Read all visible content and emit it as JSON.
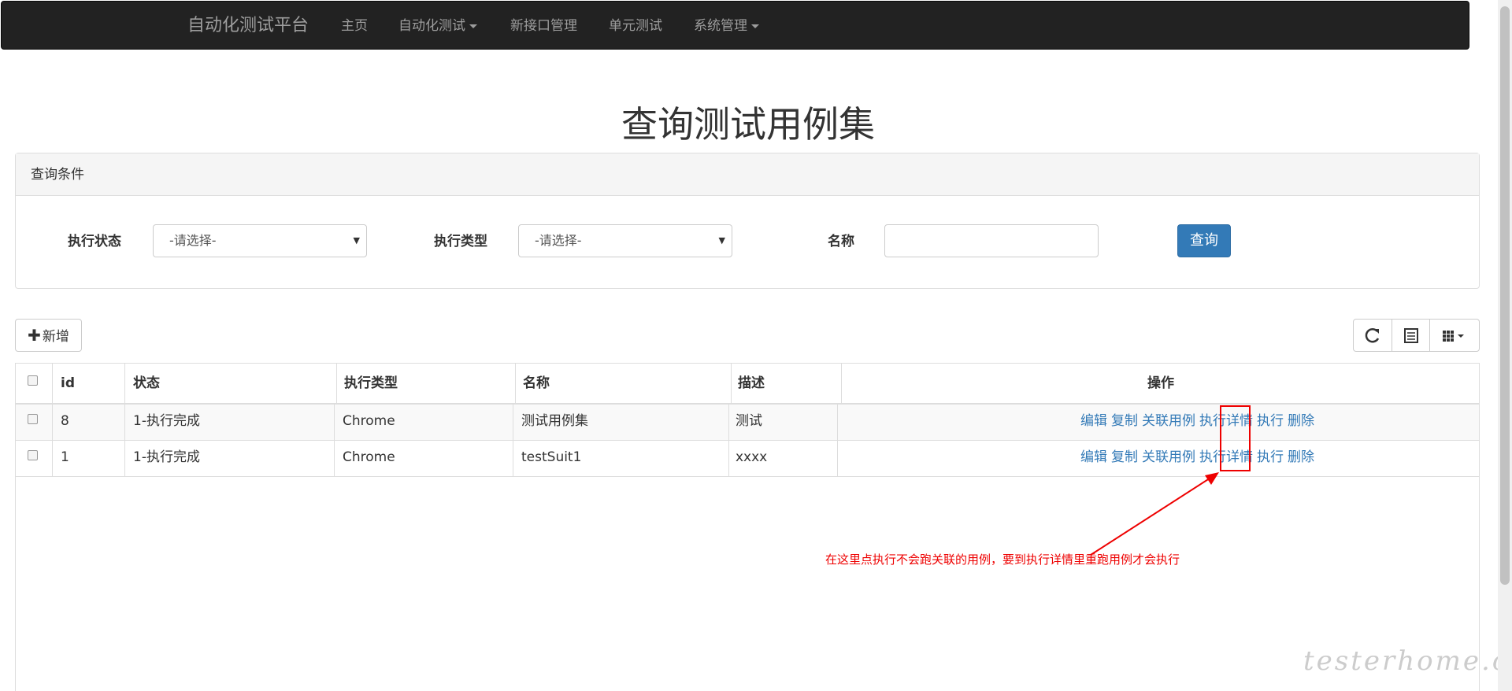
{
  "navbar": {
    "brand": "自动化测试平台",
    "items": [
      {
        "label": "主页"
      },
      {
        "label": "自动化测试"
      },
      {
        "label": "新接口管理"
      },
      {
        "label": "单元测试"
      },
      {
        "label": "系统管理"
      }
    ]
  },
  "page": {
    "title": "查询测试用例集"
  },
  "query_panel": {
    "heading": "查询条件",
    "exec_status_label": "执行状态",
    "exec_status_value": "-请选择-",
    "exec_type_label": "执行类型",
    "exec_type_value": "-请选择-",
    "name_label": "名称",
    "name_value": "",
    "query_button": "查询"
  },
  "toolbar": {
    "add_label": "新增"
  },
  "table": {
    "headers": [
      "id",
      "状态",
      "执行类型",
      "名称",
      "描述",
      "操作"
    ],
    "rows": [
      {
        "id": "8",
        "status": "1-执行完成",
        "type": "Chrome",
        "name": "测试用例集",
        "desc": "测试"
      },
      {
        "id": "1",
        "status": "1-执行完成",
        "type": "Chrome",
        "name": "testSuit1",
        "desc": "xxxx"
      }
    ],
    "actions": [
      "编辑",
      "复制",
      "关联用例",
      "执行详情",
      "执行",
      "删除"
    ]
  },
  "annotation": {
    "note": "在这里点执行不会跑关联的用例，要到执行详情里重跑用例才会执行",
    "color": "#e00000"
  },
  "watermark": "testerhome.com",
  "colors": {
    "navbar": "#222222",
    "primary": "#337ab7",
    "link": "#337ab7"
  }
}
